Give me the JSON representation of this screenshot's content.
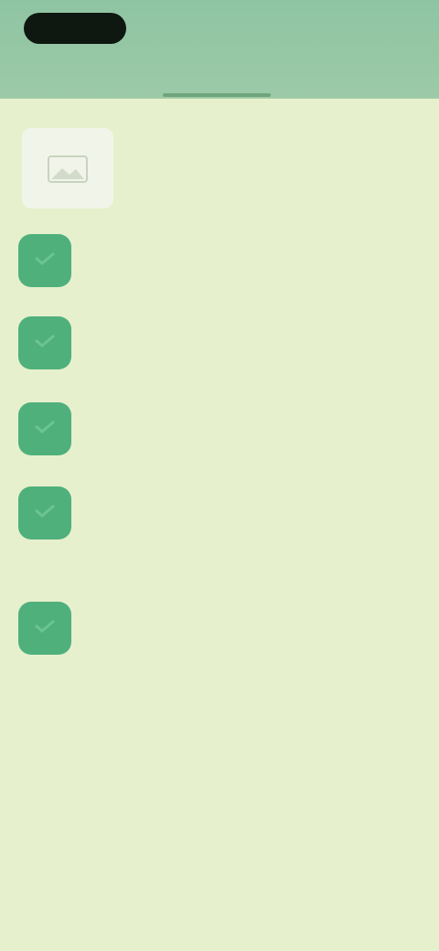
{
  "header": {
    "logo_text": "",
    "right_text": "",
    "tabs": [
      {
        "label": ""
      },
      {
        "label": ""
      }
    ]
  },
  "profile": {
    "name": "",
    "avatar_icon": "photo-icon"
  },
  "items": [
    {
      "text": ""
    },
    {
      "text": ""
    },
    {
      "text": ""
    },
    {
      "text": ""
    },
    {
      "text": ""
    }
  ],
  "colors": {
    "header": "#8fc4a2",
    "background": "#e6f0cc",
    "bullet": "#4fb07c"
  }
}
